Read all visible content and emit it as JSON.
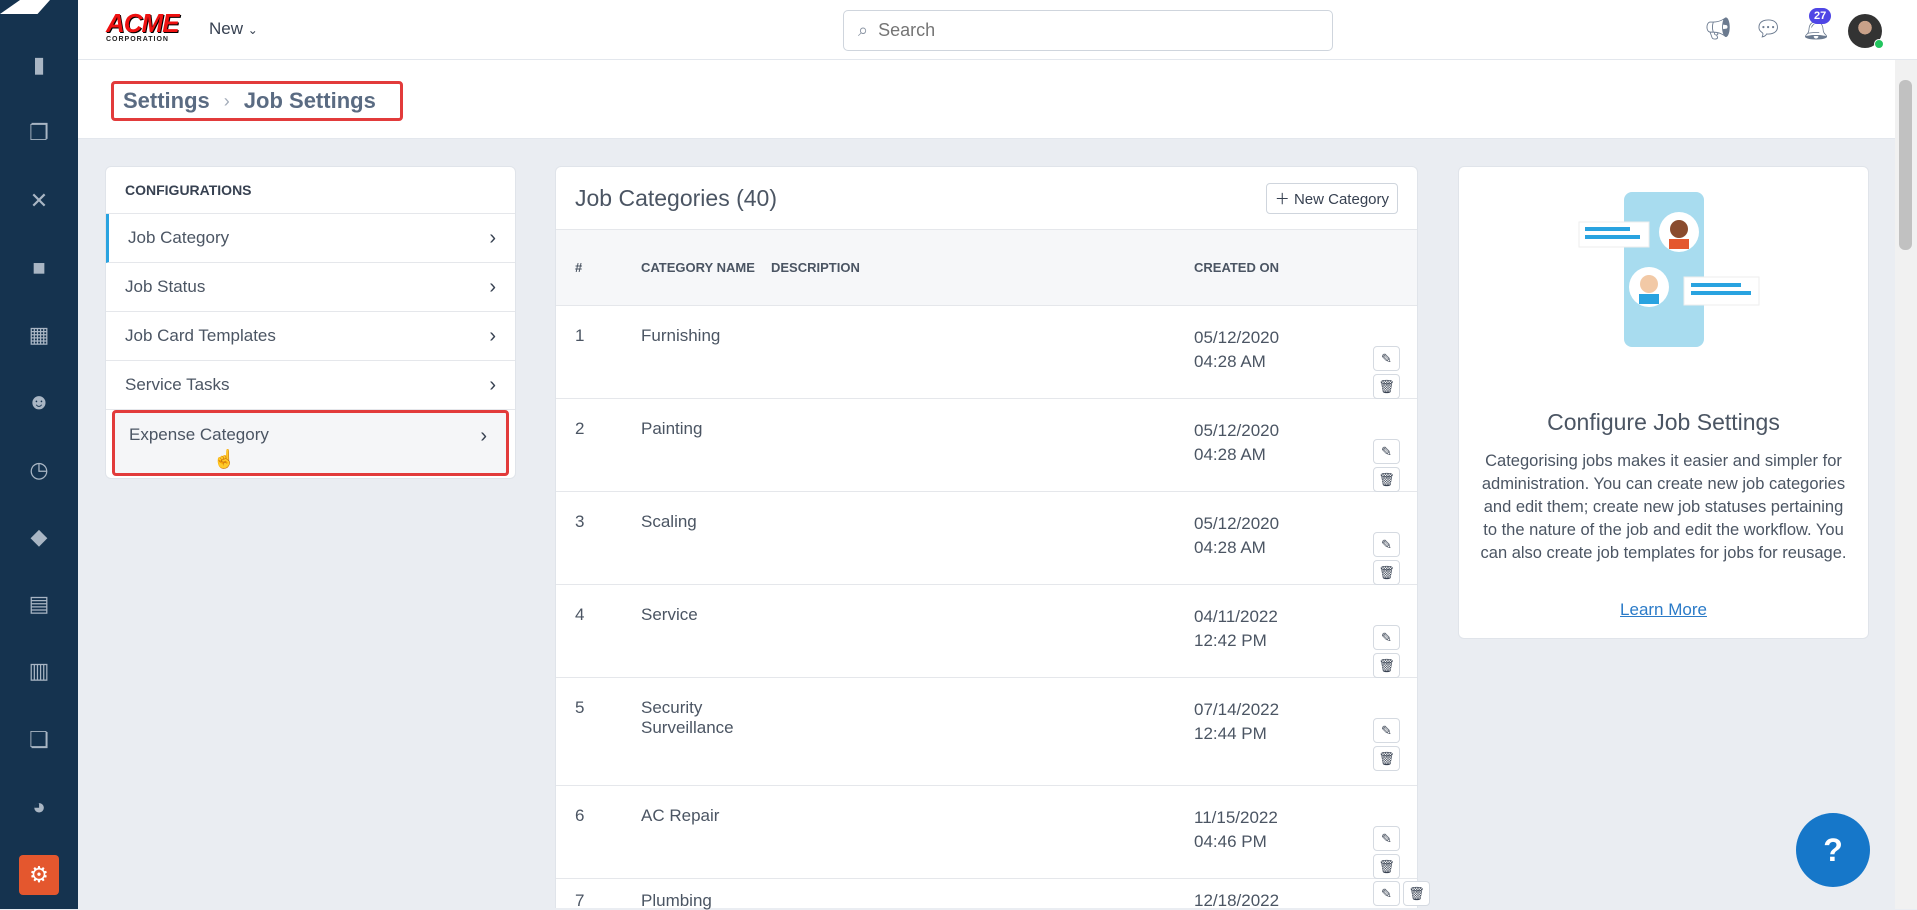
{
  "topbar": {
    "logo_text": "ACME",
    "logo_sub": "CORPORATION",
    "new_label": "New",
    "search_placeholder": "Search",
    "notification_count": "27"
  },
  "breadcrumb": {
    "parent": "Settings",
    "current": "Job Settings"
  },
  "config": {
    "title": "CONFIGURATIONS",
    "items": [
      {
        "label": "Job Category"
      },
      {
        "label": "Job Status"
      },
      {
        "label": "Job Card Templates"
      },
      {
        "label": "Service Tasks"
      },
      {
        "label": "Expense Category"
      }
    ]
  },
  "table": {
    "title": "Job Categories (40)",
    "new_button": "New Category",
    "columns": {
      "num": "#",
      "name": "CATEGORY NAME",
      "desc": "DESCRIPTION",
      "created": "CREATED ON"
    },
    "rows": [
      {
        "num": "1",
        "name": "Furnishing",
        "desc": "",
        "date": "05/12/2020",
        "time": "04:28 AM"
      },
      {
        "num": "2",
        "name": "Painting",
        "desc": "",
        "date": "05/12/2020",
        "time": "04:28 AM"
      },
      {
        "num": "3",
        "name": "Scaling",
        "desc": "",
        "date": "05/12/2020",
        "time": "04:28 AM"
      },
      {
        "num": "4",
        "name": "Service",
        "desc": "",
        "date": "04/11/2022",
        "time": "12:42 PM"
      },
      {
        "num": "5",
        "name": "Security Surveillance",
        "desc": "",
        "date": "07/14/2022",
        "time": "12:44 PM"
      },
      {
        "num": "6",
        "name": "AC Repair",
        "desc": "",
        "date": "11/15/2022",
        "time": "04:46 PM"
      },
      {
        "num": "7",
        "name": "Plumbing",
        "desc": "",
        "date": "12/18/2022",
        "time": ""
      }
    ]
  },
  "info": {
    "title": "Configure Job Settings",
    "body": "Categorising jobs makes it easier and simpler for administration. You can create new job categories and edit them; create new job statuses pertaining to the nature of the job and edit the workflow. You can also create job templates for jobs for reusage.",
    "link": "Learn More"
  },
  "colors": {
    "sidebar": "#15334f",
    "active": "#e4572e",
    "accent": "#29a3e0",
    "highlight": "#e23b3b"
  }
}
